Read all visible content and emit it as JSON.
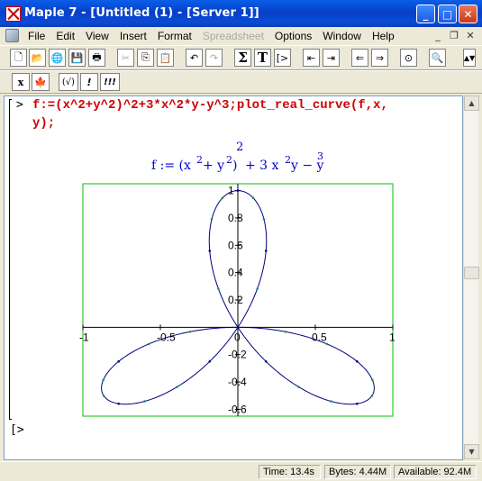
{
  "window": {
    "title": "Maple 7  - [Untitled (1) - [Server 1]]",
    "app_icon": "maple-app-icon",
    "buttons": [
      "_",
      "□",
      "✕"
    ]
  },
  "menubar": {
    "items": [
      {
        "label": "File",
        "enabled": true
      },
      {
        "label": "Edit",
        "enabled": true
      },
      {
        "label": "View",
        "enabled": true
      },
      {
        "label": "Insert",
        "enabled": true
      },
      {
        "label": "Format",
        "enabled": true
      },
      {
        "label": "Spreadsheet",
        "enabled": false
      },
      {
        "label": "Options",
        "enabled": true
      },
      {
        "label": "Window",
        "enabled": true
      },
      {
        "label": "Help",
        "enabled": true
      }
    ],
    "mdi_buttons": [
      "_",
      "❐",
      "✕"
    ]
  },
  "toolbar1": {
    "buttons": [
      {
        "name": "new-icon",
        "glyph": "🗋"
      },
      {
        "name": "open-icon",
        "glyph": "📂"
      },
      {
        "name": "open-url-icon",
        "glyph": "🌐"
      },
      {
        "name": "save-icon",
        "glyph": "💾"
      },
      {
        "name": "print-icon",
        "glyph": "🖶"
      },
      {
        "name": "cut-icon",
        "glyph": "✂",
        "disabled": true
      },
      {
        "name": "copy-icon",
        "glyph": "⎘"
      },
      {
        "name": "paste-icon",
        "glyph": "📋"
      },
      {
        "name": "undo-icon",
        "glyph": "↶"
      },
      {
        "name": "redo-icon",
        "glyph": "↷",
        "disabled": true
      },
      {
        "name": "sum-icon",
        "glyph": "Σ"
      },
      {
        "name": "text-icon",
        "glyph": "T"
      },
      {
        "name": "prompt-icon",
        "glyph": "[>"
      },
      {
        "name": "outdent-icon",
        "glyph": "⇤"
      },
      {
        "name": "indent-icon",
        "glyph": "⇥"
      },
      {
        "name": "back-icon",
        "glyph": "⇐"
      },
      {
        "name": "forward-icon",
        "glyph": "⇒"
      },
      {
        "name": "stop-icon",
        "glyph": "⊙"
      },
      {
        "name": "zoom-icon",
        "glyph": "🔍"
      }
    ]
  },
  "toolbar2": {
    "buttons": [
      {
        "name": "math-mode-icon",
        "glyph": "x"
      },
      {
        "name": "maple-leaf-icon",
        "glyph": "🍁"
      },
      {
        "name": "expression-check-icon",
        "glyph": "(√)"
      },
      {
        "name": "execute-icon",
        "glyph": "!"
      },
      {
        "name": "execute-all-icon",
        "glyph": "!!!"
      }
    ]
  },
  "worksheet": {
    "prompt": ">",
    "input_line1": "f:=(x^2+y^2)^2+3*x^2*y-y^3;plot_real_curve(f,x,",
    "input_line2": "y);",
    "output_formula": {
      "lhs": "f := (x",
      "exp2a": "2",
      "plus1": " + y",
      "exp2b": "2",
      "rparen": ")",
      "outer_exp": "2",
      "term2": "+ 3 x",
      "exp2c": "2",
      "term2b": " y − y",
      "exp3": "3"
    },
    "second_prompt": "[>"
  },
  "chart_data": {
    "type": "line",
    "title": "",
    "xlabel": "",
    "ylabel": "",
    "xlim": [
      -1.0,
      1.0
    ],
    "ylim": [
      -0.65,
      1.05
    ],
    "x_ticks": [
      "-1",
      "-0.5",
      "0",
      "0.5",
      "1"
    ],
    "y_ticks": [
      "1",
      "0.8",
      "0.6",
      "0.4",
      "0.2",
      "-0.2",
      "-0.4",
      "-0.6"
    ],
    "series": [
      {
        "equation": "(x^2+y^2)^2+3*x^2*y-y^3=0",
        "color": "#000080",
        "marker_color": "#2e8b57"
      }
    ],
    "grid": false,
    "frame_color": "#00c000"
  },
  "statusbar": {
    "time": "Time: 13.4s",
    "bytes": "Bytes: 4.44M",
    "available": "Available: 92.4M"
  }
}
